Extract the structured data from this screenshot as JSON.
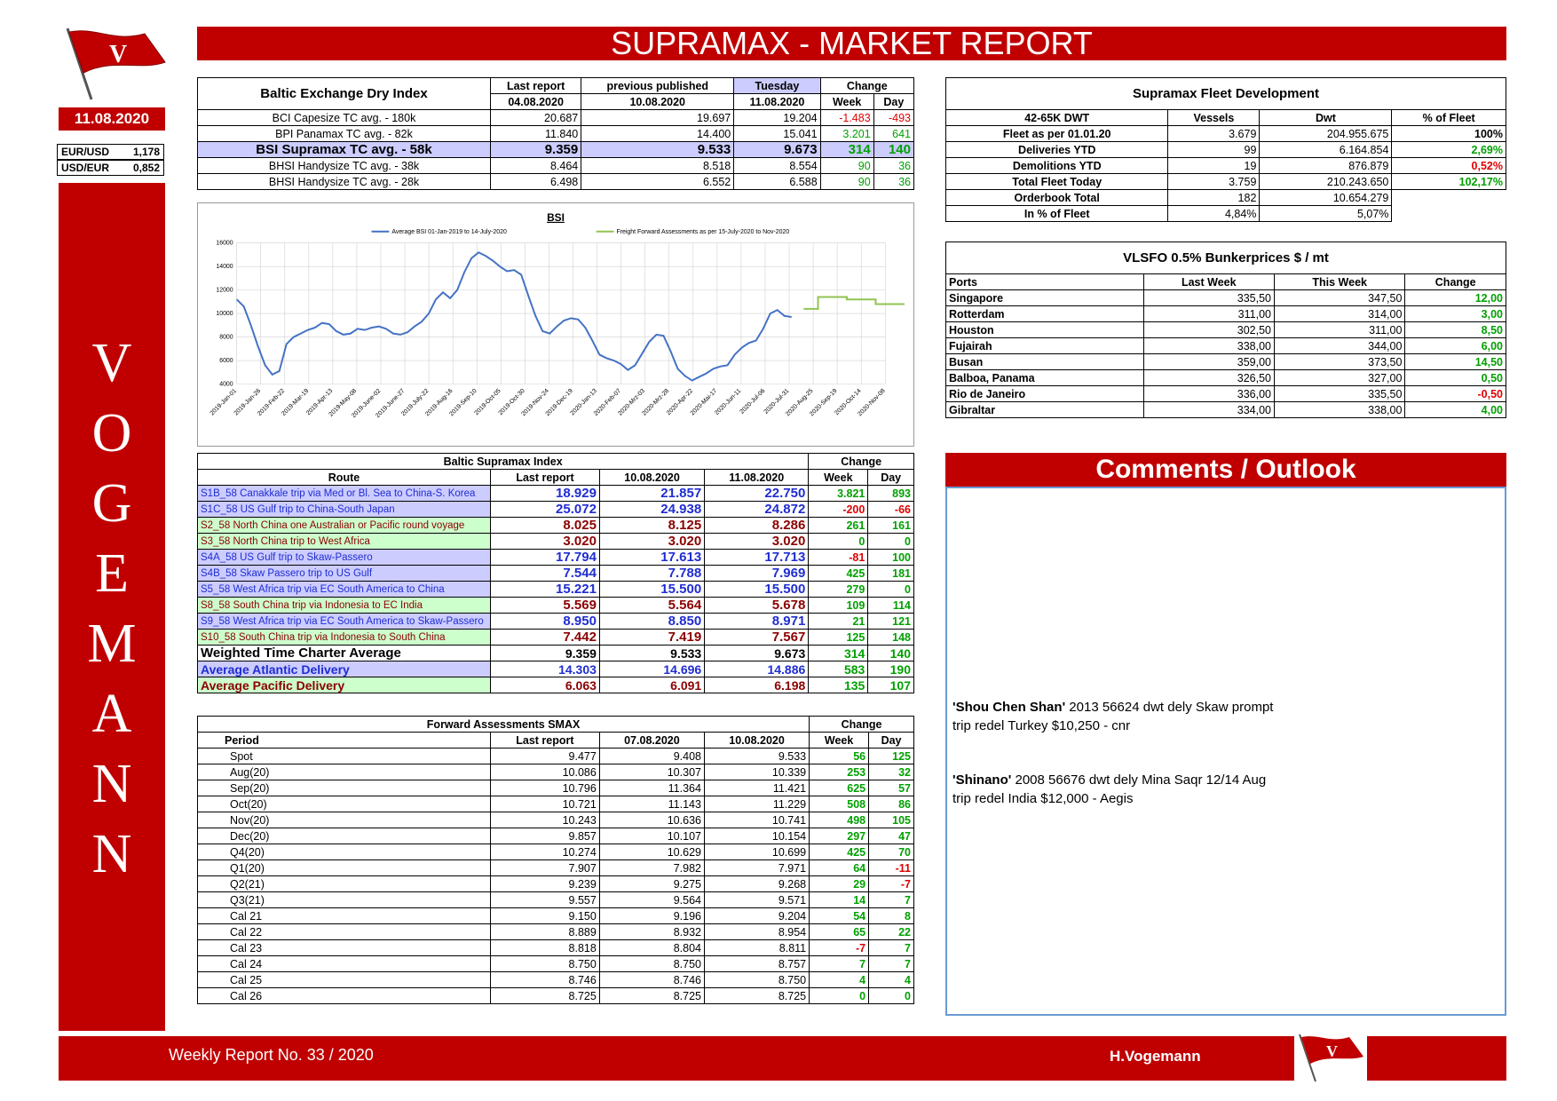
{
  "header": {
    "title": "SUPRAMAX - MARKET REPORT"
  },
  "sidebar": {
    "date": "11.08.2020",
    "fx": [
      {
        "label": "EUR/USD",
        "value": "1,178"
      },
      {
        "label": "USD/EUR",
        "value": "0,852"
      }
    ],
    "letters": [
      "V",
      "O",
      "G",
      "E",
      "M",
      "A",
      "N",
      "N"
    ]
  },
  "bdi": {
    "title": "Baltic Exchange Dry Index",
    "h_last": "Last report",
    "h_prev": "previous published",
    "h_tue": "Tuesday",
    "h_change": "Change",
    "d_last": "04.08.2020",
    "d_prev": "10.08.2020",
    "d_tue": "11.08.2020",
    "h_week": "Week",
    "h_day": "Day",
    "rows": [
      {
        "name": "BCI Capesize TC avg. - 180k",
        "last": "20.687",
        "prev": "19.697",
        "cur": "19.204",
        "week": "-1.483",
        "day": "-493"
      },
      {
        "name": "BPI Panamax TC avg. - 82k",
        "last": "11.840",
        "prev": "14.400",
        "cur": "15.041",
        "week": "3.201",
        "day": "641"
      },
      {
        "name": "BSI Supramax TC avg. - 58k",
        "last": "9.359",
        "prev": "9.533",
        "cur": "9.673",
        "week": "314",
        "day": "140"
      },
      {
        "name": "BHSI Handysize TC avg. - 38k",
        "last": "8.464",
        "prev": "8.518",
        "cur": "8.554",
        "week": "90",
        "day": "36"
      },
      {
        "name": "BHSI Handysize TC avg. - 28k",
        "last": "6.498",
        "prev": "6.552",
        "cur": "6.588",
        "week": "90",
        "day": "36"
      }
    ]
  },
  "fleet": {
    "title": "Supramax Fleet Development",
    "headers": [
      "42-65K DWT",
      "Vessels",
      "Dwt",
      "% of Fleet"
    ],
    "rows": [
      {
        "label": "Fleet as per 01.01.20",
        "vessels": "3.679",
        "dwt": "204.955.675",
        "pct": "100%",
        "cls": ""
      },
      {
        "label": "Deliveries YTD",
        "vessels": "99",
        "dwt": "6.164.854",
        "pct": "2,69%",
        "cls": "pos"
      },
      {
        "label": "Demolitions YTD",
        "vessels": "19",
        "dwt": "876.879",
        "pct": "0,52%",
        "cls": "neg"
      },
      {
        "label": "Total Fleet Today",
        "vessels": "3.759",
        "dwt": "210.243.650",
        "pct": "102,17%",
        "cls": "pos"
      },
      {
        "label": "Orderbook Total",
        "vessels": "182",
        "dwt": "10.654.279",
        "pct": "",
        "cls": ""
      },
      {
        "label": "In % of Fleet",
        "vessels": "4,84%",
        "dwt": "5,07%",
        "pct": "",
        "cls": ""
      }
    ]
  },
  "bunker": {
    "title": "VLSFO 0.5% Bunkerprices $ / mt",
    "headers": [
      "Ports",
      "Last Week",
      "This Week",
      "Change"
    ],
    "rows": [
      {
        "port": "Singapore",
        "last": "335,50",
        "cur": "347,50",
        "chg": "12,00",
        "cls": "pos"
      },
      {
        "port": "Rotterdam",
        "last": "311,00",
        "cur": "314,00",
        "chg": "3,00",
        "cls": "pos"
      },
      {
        "port": "Houston",
        "last": "302,50",
        "cur": "311,00",
        "chg": "8,50",
        "cls": "pos"
      },
      {
        "port": "Fujairah",
        "last": "338,00",
        "cur": "344,00",
        "chg": "6,00",
        "cls": "pos"
      },
      {
        "port": "Busan",
        "last": "359,00",
        "cur": "373,50",
        "chg": "14,50",
        "cls": "pos"
      },
      {
        "port": "Balboa, Panama",
        "last": "326,50",
        "cur": "327,00",
        "chg": "0,50",
        "cls": "pos"
      },
      {
        "port": "Rio de Janeiro",
        "last": "336,00",
        "cur": "335,50",
        "chg": "-0,50",
        "cls": "neg"
      },
      {
        "port": "Gibraltar",
        "last": "334,00",
        "cur": "338,00",
        "chg": "4,00",
        "cls": "pos"
      }
    ]
  },
  "bsi_routes": {
    "title": "Baltic Supramax Index",
    "h_change": "Change",
    "headers": [
      "Route",
      "Last report",
      "10.08.2020",
      "11.08.2020",
      "Week",
      "Day"
    ],
    "rows": [
      {
        "route": "S1B_58 Canakkale trip via Med or Bl. Sea to China-S. Korea",
        "last": "18.929",
        "prev": "21.857",
        "cur": "22.750",
        "week": "3.821",
        "day": "893",
        "grp": "atl"
      },
      {
        "route": "S1C_58 US Gulf trip to China-South Japan",
        "last": "25.072",
        "prev": "24.938",
        "cur": "24.872",
        "week": "-200",
        "day": "-66",
        "grp": "atl"
      },
      {
        "route": "S2_58 North China one Australian or Pacific round voyage",
        "last": "8.025",
        "prev": "8.125",
        "cur": "8.286",
        "week": "261",
        "day": "161",
        "grp": "pac"
      },
      {
        "route": "S3_58 North China trip to West Africa",
        "last": "3.020",
        "prev": "3.020",
        "cur": "3.020",
        "week": "0",
        "day": "0",
        "grp": "pac"
      },
      {
        "route": "S4A_58 US Gulf trip to Skaw-Passero",
        "last": "17.794",
        "prev": "17.613",
        "cur": "17.713",
        "week": "-81",
        "day": "100",
        "grp": "atl"
      },
      {
        "route": "S4B_58 Skaw Passero trip to US Gulf",
        "last": "7.544",
        "prev": "7.788",
        "cur": "7.969",
        "week": "425",
        "day": "181",
        "grp": "atl"
      },
      {
        "route": "S5_58 West Africa trip via EC South America to China",
        "last": "15.221",
        "prev": "15.500",
        "cur": "15.500",
        "week": "279",
        "day": "0",
        "grp": "atl"
      },
      {
        "route": "S8_58 South China trip via Indonesia to EC India",
        "last": "5.569",
        "prev": "5.564",
        "cur": "5.678",
        "week": "109",
        "day": "114",
        "grp": "pac"
      },
      {
        "route": "S9_58 West Africa trip via EC South America to Skaw-Passero",
        "last": "8.950",
        "prev": "8.850",
        "cur": "8.971",
        "week": "21",
        "day": "121",
        "grp": "atl"
      },
      {
        "route": "S10_58 South China trip via Indonesia to South China",
        "last": "7.442",
        "prev": "7.419",
        "cur": "7.567",
        "week": "125",
        "day": "148",
        "grp": "pac"
      }
    ],
    "summary": [
      {
        "route": "Weighted Time Charter Average",
        "last": "9.359",
        "prev": "9.533",
        "cur": "9.673",
        "week": "314",
        "day": "140",
        "grp": "wtc"
      },
      {
        "route": "Average Atlantic Delivery",
        "last": "14.303",
        "prev": "14.696",
        "cur": "14.886",
        "week": "583",
        "day": "190",
        "grp": "atl"
      },
      {
        "route": "Average Pacific Delivery",
        "last": "6.063",
        "prev": "6.091",
        "cur": "6.198",
        "week": "135",
        "day": "107",
        "grp": "pac"
      }
    ]
  },
  "ffa": {
    "title": "Forward Assessments SMAX",
    "h_change": "Change",
    "headers": [
      "Period",
      "Last report",
      "07.08.2020",
      "10.08.2020",
      "Week",
      "Day"
    ],
    "rows": [
      {
        "period": "Spot",
        "last": "9.477",
        "prev": "9.408",
        "cur": "9.533",
        "week": "56",
        "day": "125"
      },
      {
        "period": "Aug(20)",
        "last": "10.086",
        "prev": "10.307",
        "cur": "10.339",
        "week": "253",
        "day": "32"
      },
      {
        "period": "Sep(20)",
        "last": "10.796",
        "prev": "11.364",
        "cur": "11.421",
        "week": "625",
        "day": "57"
      },
      {
        "period": "Oct(20)",
        "last": "10.721",
        "prev": "11.143",
        "cur": "11.229",
        "week": "508",
        "day": "86"
      },
      {
        "period": "Nov(20)",
        "last": "10.243",
        "prev": "10.636",
        "cur": "10.741",
        "week": "498",
        "day": "105"
      },
      {
        "period": "Dec(20)",
        "last": "9.857",
        "prev": "10.107",
        "cur": "10.154",
        "week": "297",
        "day": "47"
      },
      {
        "period": "Q4(20)",
        "last": "10.274",
        "prev": "10.629",
        "cur": "10.699",
        "week": "425",
        "day": "70"
      },
      {
        "period": "Q1(20)",
        "last": "7.907",
        "prev": "7.982",
        "cur": "7.971",
        "week": "64",
        "day": "-11"
      },
      {
        "period": "Q2(21)",
        "last": "9.239",
        "prev": "9.275",
        "cur": "9.268",
        "week": "29",
        "day": "-7"
      },
      {
        "period": "Q3(21)",
        "last": "9.557",
        "prev": "9.564",
        "cur": "9.571",
        "week": "14",
        "day": "7"
      },
      {
        "period": "Cal 21",
        "last": "9.150",
        "prev": "9.196",
        "cur": "9.204",
        "week": "54",
        "day": "8"
      },
      {
        "period": "Cal 22",
        "last": "8.889",
        "prev": "8.932",
        "cur": "8.954",
        "week": "65",
        "day": "22"
      },
      {
        "period": "Cal 23",
        "last": "8.818",
        "prev": "8.804",
        "cur": "8.811",
        "week": "-7",
        "day": "7"
      },
      {
        "period": "Cal 24",
        "last": "8.750",
        "prev": "8.750",
        "cur": "8.757",
        "week": "7",
        "day": "7"
      },
      {
        "period": "Cal 25",
        "last": "8.746",
        "prev": "8.746",
        "cur": "8.750",
        "week": "4",
        "day": "4"
      },
      {
        "period": "Cal 26",
        "last": "8.725",
        "prev": "8.725",
        "cur": "8.725",
        "week": "0",
        "day": "0"
      }
    ]
  },
  "chart_data": {
    "type": "line",
    "title": "BSI",
    "ylim": [
      4000,
      16000
    ],
    "yticks": [
      4000,
      6000,
      8000,
      10000,
      12000,
      14000,
      16000
    ],
    "xticks": [
      "2019-Jan-01",
      "2019-Jan-26",
      "2019-Feb-22",
      "2019-Mar-19",
      "2019-Apr-13",
      "2019-May-08",
      "2019-June-02",
      "2019-June-27",
      "2019-July-22",
      "2019-Aug-16",
      "2019-Sep-10",
      "2019-Oct-05",
      "2019-Oct-30",
      "2019-Nov-24",
      "2019-Dec-19",
      "2020-Jan-13",
      "2020-Feb-07",
      "2020-Mrz-03",
      "2020-Mrz-28",
      "2020-Apr-22",
      "2020-Mai-17",
      "2020-Jun-11",
      "2020-Jul-06",
      "2020-Jul-31",
      "2020-Aug-25",
      "2020-Sep-19",
      "2020-Oct-14",
      "2020-Nov-08"
    ],
    "series": [
      {
        "name": "Average BSI 01-Jan-2019 to 14-July-2020",
        "color": "#4472c4",
        "values": [
          11200,
          10600,
          9000,
          7200,
          5600,
          4800,
          5100,
          7400,
          8000,
          8300,
          8600,
          8800,
          9200,
          9100,
          8500,
          8200,
          8300,
          8700,
          8600,
          8800,
          8900,
          8700,
          8300,
          8200,
          8400,
          8900,
          9300,
          10000,
          11200,
          11800,
          11300,
          12000,
          13500,
          14700,
          15200,
          14900,
          14500,
          14000,
          13600,
          13700,
          13300,
          11500,
          9800,
          8500,
          8300,
          8900,
          9400,
          9600,
          9500,
          8800,
          7700,
          6500,
          6200,
          6000,
          5700,
          5200,
          5600,
          6600,
          7600,
          8200,
          8100,
          6800,
          5300,
          4700,
          4300,
          4600,
          4900,
          5300,
          5500,
          5600,
          6500,
          7100,
          7500,
          7700,
          8700,
          10000,
          10300,
          9800,
          9700
        ]
      },
      {
        "name": "Freight Forward Assessments as per 15-July-2020 to Nov-2020",
        "color": "#92c353",
        "values": [
          10400,
          11400,
          11400,
          11200,
          11200,
          10800,
          10800
        ]
      }
    ]
  },
  "comments": {
    "title": "Comments / Outlook",
    "items": [
      {
        "ship": "'Shou Chen Shan'",
        "line1": " 2013 56624 dwt dely Skaw prompt",
        "line2": "trip redel Turkey $10,250 - cnr"
      },
      {
        "ship": "'Shinano'",
        "line1": " 2008 56676 dwt dely Mina Saqr 12/14 Aug",
        "line2": "trip redel India $12,000 - Aegis"
      }
    ]
  },
  "footer": {
    "report": "Weekly Report No. 33 / 2020",
    "company": "H.Vogemann"
  }
}
